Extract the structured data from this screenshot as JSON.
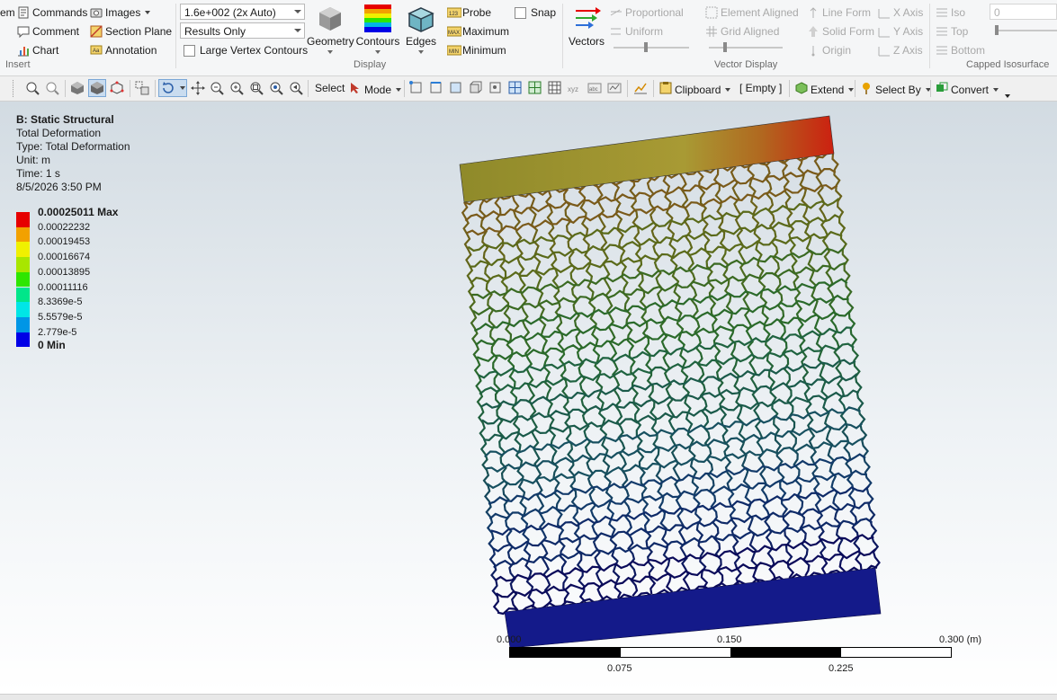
{
  "ribbon": {
    "insert": {
      "partial_label": "em",
      "commands": "Commands",
      "comment": "Comment",
      "chart": "Chart",
      "images": "Images",
      "section_plane": "Section Plane",
      "annotation": "Annotation",
      "group_label": "Insert"
    },
    "display": {
      "scale_value": "1.6e+002 (2x Auto)",
      "results_mode": "Results Only",
      "large_vertex_contours": "Large Vertex Contours",
      "geometry": "Geometry",
      "contours": "Contours",
      "edges": "Edges",
      "probe": "Probe",
      "maximum": "Maximum",
      "minimum": "Minimum",
      "snap": "Snap",
      "group_label": "Display"
    },
    "vector_display": {
      "vectors": "Vectors",
      "proportional": "Proportional",
      "uniform": "Uniform",
      "element_aligned": "Element Aligned",
      "grid_aligned": "Grid Aligned",
      "line_form": "Line Form",
      "solid_form": "Solid Form",
      "origin": "Origin",
      "x_axis": "X Axis",
      "y_axis": "Y Axis",
      "z_axis": "Z Axis",
      "group_label": "Vector Display"
    },
    "capped_isosurface": {
      "iso": "Iso",
      "top": "Top",
      "bottom": "Bottom",
      "value": "0",
      "group_label": "Capped Isosurface"
    }
  },
  "toolbar": {
    "select": "Select",
    "mode": "Mode",
    "clipboard": "Clipboard",
    "empty": "[ Empty ]",
    "extend": "Extend",
    "select_by": "Select By",
    "convert": "Convert"
  },
  "result": {
    "title": "B: Static Structural",
    "name": "Total Deformation",
    "type": "Type: Total Deformation",
    "unit": "Unit: m",
    "time": "Time: 1 s",
    "date": "8/5/2026 3:50 PM"
  },
  "legend": {
    "max_label": "0.00025011 Max",
    "values": [
      "0.00022232",
      "0.00019453",
      "0.00016674",
      "0.00013895",
      "0.00011116",
      "8.3369e-5",
      "5.5579e-5",
      "2.779e-5"
    ],
    "min_label": "0 Min",
    "colors": [
      "#e60000",
      "#f2a100",
      "#f0f000",
      "#a8e600",
      "#2ee600",
      "#00e68a",
      "#00e6e6",
      "#0096e6",
      "#0000e6"
    ]
  },
  "scale_bar": {
    "top_labels": [
      "0.000",
      "0.150",
      "0.300 (m)"
    ],
    "bottom_labels": [
      "0.075",
      "0.225"
    ]
  },
  "colors": {
    "top_plate": "#a89a34",
    "top_plate_hot": "#cc2010",
    "bottom_plate": "#141a8a"
  }
}
